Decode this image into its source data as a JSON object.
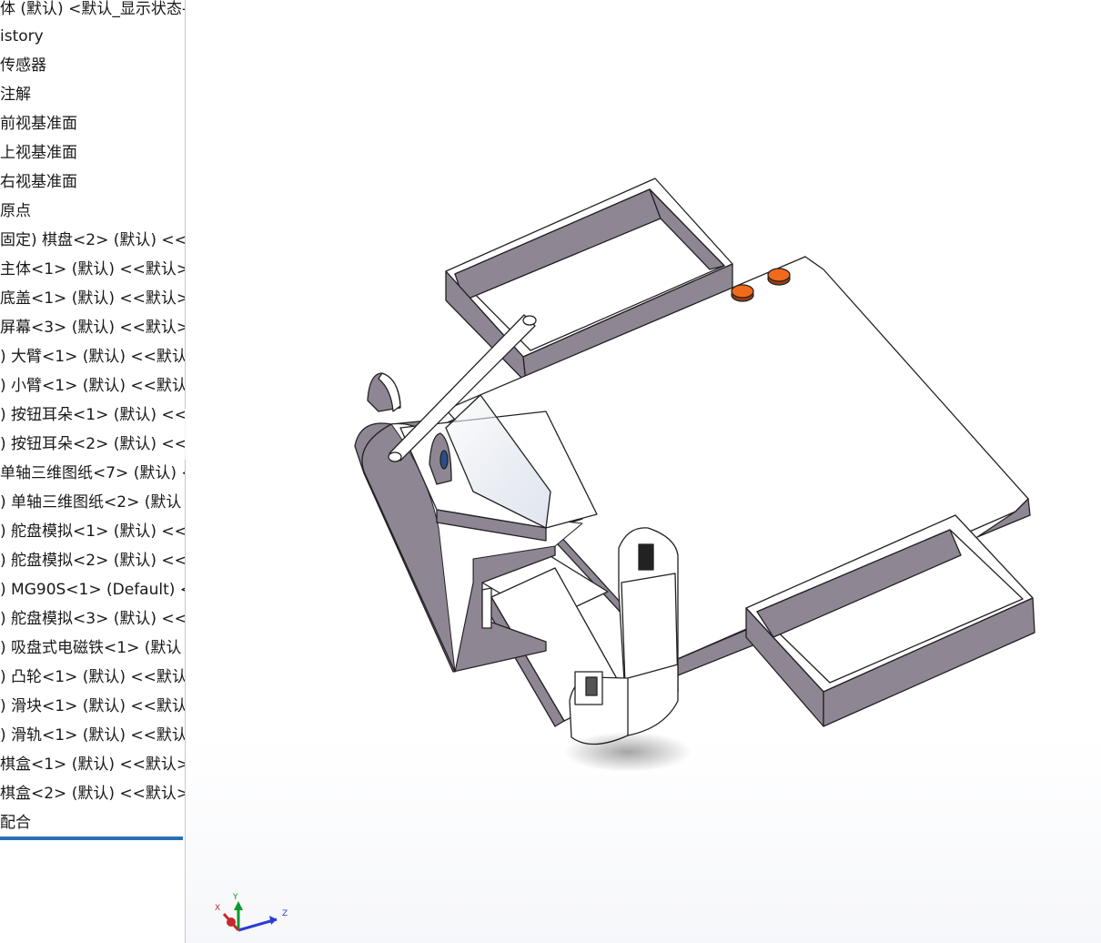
{
  "feature_tree": {
    "items": [
      {
        "label": "体 (默认) <默认_显示状态-"
      },
      {
        "label": "istory"
      },
      {
        "label": "传感器"
      },
      {
        "label": "注解"
      },
      {
        "label": "前视基准面"
      },
      {
        "label": "上视基准面"
      },
      {
        "label": "右视基准面"
      },
      {
        "label": "原点"
      },
      {
        "label": "固定) 棋盘<2> (默认) <<默"
      },
      {
        "label": "主体<1> (默认) <<默认>_"
      },
      {
        "label": "底盖<1> (默认) <<默认>_"
      },
      {
        "label": "屏幕<3> (默认) <<默认>_"
      },
      {
        "label": ") 大臂<1> (默认) <<默认"
      },
      {
        "label": ") 小臂<1> (默认) <<默认"
      },
      {
        "label": ") 按钮耳朵<1> (默认) <<"
      },
      {
        "label": ") 按钮耳朵<2> (默认) <<"
      },
      {
        "label": "单轴三维图纸<7> (默认) <"
      },
      {
        "label": ") 单轴三维图纸<2> (默认"
      },
      {
        "label": ") 舵盘模拟<1> (默认) <<"
      },
      {
        "label": ") 舵盘模拟<2> (默认) <<"
      },
      {
        "label": ") MG90S<1> (Default) <"
      },
      {
        "label": ") 舵盘模拟<3> (默认) <<"
      },
      {
        "label": ") 吸盘式电磁铁<1> (默认"
      },
      {
        "label": ") 凸轮<1> (默认) <<默认"
      },
      {
        "label": ") 滑块<1> (默认) <<默认"
      },
      {
        "label": ") 滑轨<1> (默认) <<默认"
      },
      {
        "label": "棋盒<1> (默认) <<默认>_"
      },
      {
        "label": "棋盒<2> (默认) <<默认>_"
      },
      {
        "label": "配合"
      }
    ]
  },
  "triad": {
    "x_label": "X",
    "y_label": "Y",
    "z_label": "Z"
  },
  "colors": {
    "model_face": "#ffffff",
    "model_side": "#8f8694",
    "model_edge": "#222222",
    "button_orange": "#f26a1b",
    "selection_underline": "#2c6fb6"
  }
}
